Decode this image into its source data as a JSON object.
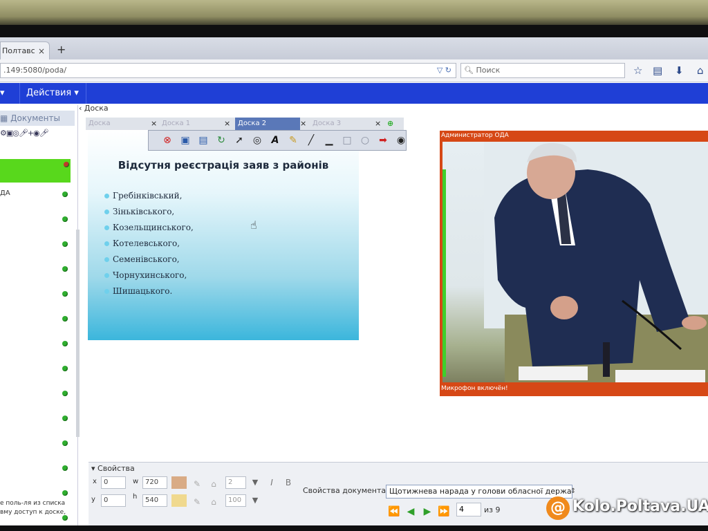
{
  "browser": {
    "tab_title": "Полтавс",
    "tab_close": "×",
    "new_tab": "+",
    "url": ".149:5080/poda/",
    "search_placeholder": "Поиск"
  },
  "app_menu": {
    "items": [
      "Действия"
    ]
  },
  "left_panel": {
    "documents_tab": "Документы",
    "user_label": "ДА",
    "note": "е поль-ля из списка вму доступ к доске,"
  },
  "board": {
    "header": "Доска",
    "tabs": [
      "Доска",
      "Доска 1",
      "Доска 2",
      "Доска 3"
    ],
    "active_tab_index": 2
  },
  "slide": {
    "title": "Відсутня реєстрація заяв з районів",
    "items": [
      "Гребінківський,",
      "Зіньківського,",
      "Козельщинського,",
      "Котелевського,",
      "Семенівського,",
      "Чорнухинського,",
      "Шишацького."
    ]
  },
  "video": {
    "title": "Администратор ОДА",
    "footer": "Микрофон включён!"
  },
  "properties": {
    "header": "Свойства",
    "x_label": "x",
    "x_value": "0",
    "w_label": "w",
    "w_value": "720",
    "y_value": "0",
    "h_label": "h",
    "h_value": "540",
    "line_width": "2",
    "opacity": "100",
    "italic": "I",
    "bold": "B",
    "doc_props_label": "Свойства документа",
    "doc_name": "Щотижнева нарада у голови обласної держав",
    "page_current": "4",
    "page_total": "из 9"
  },
  "watermark": {
    "symbol": "@",
    "text": "Kolo.Poltava.UA"
  },
  "colors": {
    "menubar": "#1f3fd6",
    "active_user": "#58d81c",
    "video_frame": "#d64816",
    "status_dot": "#2fae2f"
  }
}
